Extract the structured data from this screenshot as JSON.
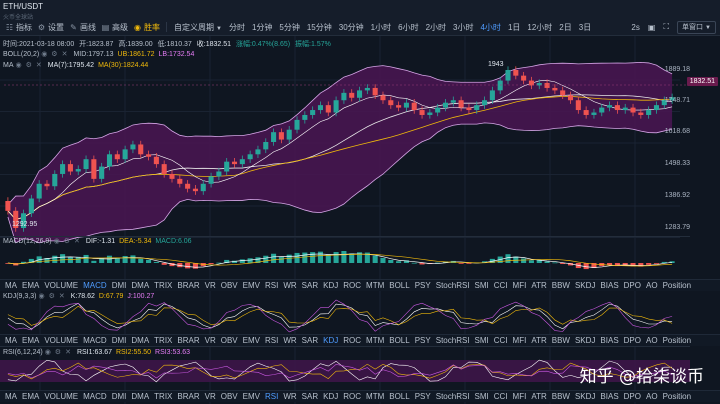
{
  "header": {
    "pair": "ETH/USDT",
    "subtitle": "火币全球站",
    "tools": [
      {
        "label": "指标",
        "icon": "indicator-icon"
      },
      {
        "label": "设置",
        "icon": "gear-icon"
      },
      {
        "label": "画线",
        "icon": "draw-line-icon"
      },
      {
        "label": "高级",
        "icon": "advanced-icon"
      },
      {
        "label": "胜率",
        "icon": "win-rate-icon"
      }
    ],
    "custom_period": "自定义周期",
    "timeframes": [
      "分时",
      "1分钟",
      "5分钟",
      "15分钟",
      "30分钟",
      "1小时",
      "6小时",
      "2小时",
      "3小时",
      "4小时",
      "1日",
      "12小时",
      "2日",
      "3日"
    ],
    "active_timeframe": "4小时",
    "auto": "2s",
    "layout": "单窗口"
  },
  "main_info": {
    "time": "时间:2021-03-18 08:00",
    "open": "开:1823.87",
    "high": "高:1839.00",
    "low": "低:1810.37",
    "close": "收:1832.51",
    "change": "涨幅:0.47%(8.65)",
    "amplitude": "振幅:1.57%"
  },
  "boll": {
    "name": "BOLL(20,2)",
    "mid": "MID:1797.13",
    "ub": "UB:1861.72",
    "lb": "LB:1732.54"
  },
  "ma": {
    "name": "MA",
    "ma7": "MA(7):1795.42",
    "ma30": "MA(30):1824.44"
  },
  "price_axis": [
    "1889.18",
    "1748.71",
    "1618.68",
    "1498.33",
    "1386.92",
    "1283.79"
  ],
  "current_price": "1832.51",
  "annotations": {
    "high": "1943",
    "low": "1292.95"
  },
  "macd": {
    "name": "MACD(12,26,9)",
    "dif": "DIF:-1.31",
    "dea": "DEA:-5.34",
    "macd": "MACD:6.06"
  },
  "kdj": {
    "name": "KDJ(9,3,3)",
    "k": "K:78.62",
    "d": "D:67.79",
    "j": "J:100.27"
  },
  "rsi": {
    "name": "RSI(6,12,24)",
    "r1": "RSI1:63.67",
    "r2": "RSI2:55.50",
    "r3": "RSI3:53.63"
  },
  "indicator_tabs": [
    "MA",
    "EMA",
    "VOLUME",
    "MACD",
    "DMI",
    "DMA",
    "TRIX",
    "BRAR",
    "VR",
    "OBV",
    "EMV",
    "RSI",
    "WR",
    "SAR",
    "KDJ",
    "ROC",
    "MTM",
    "BOLL",
    "PSY",
    "StochRSI",
    "SMI",
    "CCI",
    "MFI",
    "ATR",
    "BBW",
    "SKDJ",
    "BIAS",
    "DPO",
    "AO",
    "Position"
  ],
  "tabs_row1_active": "MACD",
  "tabs_row2_active": "KDJ",
  "tabs_row3_active": "RSI",
  "watermark": "知乎 @拾柒谈币",
  "colors": {
    "up": "#26a69a",
    "down": "#ef5350",
    "band": "#4a1552",
    "accent": "#4f9cff",
    "yellow": "#f0b90b"
  },
  "chart_data": {
    "type": "candlestick",
    "x_range": [
      "2021-02-14",
      "2021-03-18 08:00"
    ],
    "interval": "4h",
    "ylim": [
      1283.79,
      1943
    ],
    "close": [
      1370,
      1300,
      1360,
      1420,
      1480,
      1470,
      1520,
      1560,
      1530,
      1540,
      1580,
      1500,
      1550,
      1600,
      1580,
      1620,
      1640,
      1600,
      1590,
      1560,
      1520,
      1500,
      1480,
      1460,
      1450,
      1480,
      1510,
      1530,
      1570,
      1560,
      1580,
      1600,
      1620,
      1650,
      1690,
      1660,
      1700,
      1740,
      1760,
      1780,
      1800,
      1770,
      1820,
      1850,
      1830,
      1860,
      1870,
      1840,
      1820,
      1800,
      1790,
      1810,
      1780,
      1760,
      1770,
      1790,
      1810,
      1820,
      1790,
      1780,
      1800,
      1820,
      1860,
      1900,
      1943,
      1920,
      1900,
      1880,
      1890,
      1870,
      1860,
      1840,
      1820,
      1780,
      1760,
      1770,
      1790,
      1800,
      1780,
      1790,
      1770,
      1760,
      1780,
      1800,
      1820,
      1832
    ]
  }
}
